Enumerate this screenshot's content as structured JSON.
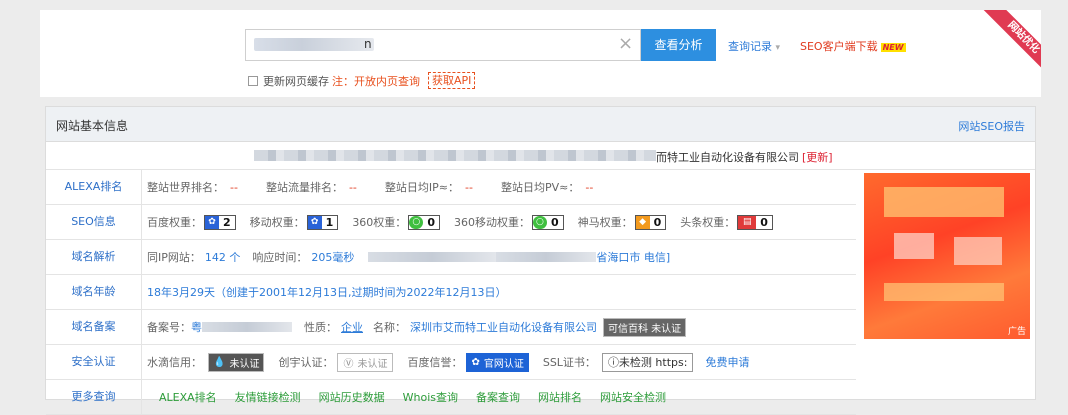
{
  "search": {
    "value_tail": "n",
    "analyze_button": "查看分析",
    "history_link": "查询记录",
    "seo_client": "SEO客户端下载",
    "new_badge": "NEW",
    "refresh_cache_label": "更新网页缓存",
    "note": "注：开放内页查询",
    "api_link": "获取API",
    "clear_icon": "close-icon"
  },
  "ribbon": "网站优化",
  "section": {
    "title": "网站基本信息",
    "report_link": "网站SEO报告",
    "site_name_tail": "而特工业自动化设备有限公司",
    "update_link": "[更新]"
  },
  "rows": {
    "alexa": {
      "label": "ALEXA排名",
      "world_rank_label": "整站世界排名：",
      "world_rank": "--",
      "traffic_rank_label": "整站流量排名：",
      "traffic_rank": "--",
      "daily_ip_label": "整站日均IP≈：",
      "daily_ip": "--",
      "daily_pv_label": "整站日均PV≈：",
      "daily_pv": "--"
    },
    "seo": {
      "label": "SEO信息",
      "baidu_label": "百度权重：",
      "baidu": "2",
      "mobile_label": "移动权重：",
      "mobile": "1",
      "s360_label": "360权重：",
      "s360": "0",
      "s360m_label": "360移动权重：",
      "s360m": "0",
      "shenma_label": "神马权重：",
      "shenma": "0",
      "toutiao_label": "头条权重：",
      "toutiao": "0"
    },
    "dns": {
      "label": "域名解析",
      "same_ip_label": "同IP网站：",
      "same_ip": "142 个",
      "resp_label": "响应时间：",
      "resp": "205毫秒",
      "location_tail": "省海口市 电信]"
    },
    "age": {
      "label": "域名年龄",
      "value": "18年3月29天（创建于2001年12月13日,过期时间为2022年12月13日）"
    },
    "icp": {
      "label": "域名备案",
      "no_label": "备案号：",
      "no_head": "粤",
      "nature_label": "性质：",
      "nature": "企业",
      "name_label": "名称：",
      "name": "深圳市艾而特工业自动化设备有限公司",
      "badge": "可信百科 未认证"
    },
    "security": {
      "label": "安全认证",
      "shuidi_label": "水滴信用：",
      "shuidi_tag": "未认证",
      "chuangyu_label": "创宇认证：",
      "chuangyu_tag": "未认证",
      "baidu_label": "百度信誉：",
      "baidu_tag": "官网认证",
      "ssl_label": "SSL证书：",
      "ssl_tag": "ⓘ未检测 https:",
      "free_apply": "免费申请"
    },
    "more": {
      "label": "更多查询",
      "links": [
        "ALEXA排名",
        "友情链接检测",
        "网站历史数据",
        "Whois查询",
        "备案查询",
        "网站排名",
        "网站安全检测"
      ]
    }
  },
  "ad_label": "广告",
  "colors": {
    "accent": "#2d8fe0",
    "link": "#2d7bd8",
    "warn": "#e03a1e",
    "green": "#2d9c3a"
  }
}
